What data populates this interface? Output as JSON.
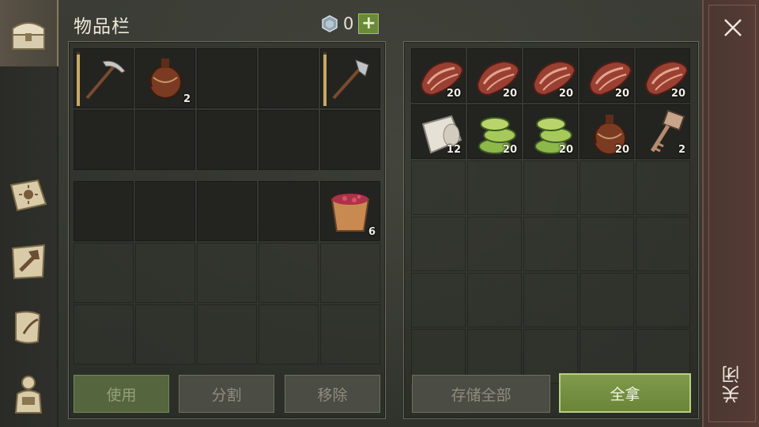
{
  "header": {
    "title": "物品栏",
    "currency_count": "0",
    "add_label": "+"
  },
  "close": {
    "label": "关闭"
  },
  "sidebar": [
    {
      "name": "chest-tab",
      "icon": "chest-icon",
      "active": true
    },
    {
      "name": "sun-book-tab",
      "icon": "sun-book-icon",
      "active": false
    },
    {
      "name": "crafting-tab",
      "icon": "hammer-map-icon",
      "active": false
    },
    {
      "name": "scroll-tab",
      "icon": "quest-scroll-icon",
      "active": false
    },
    {
      "name": "character-tab",
      "icon": "character-icon",
      "active": false
    }
  ],
  "hotbar": [
    {
      "item": "pickaxe",
      "qty": "",
      "durability": 0.95
    },
    {
      "item": "flask",
      "qty": "2"
    },
    {
      "item": "",
      "qty": ""
    },
    {
      "item": "",
      "qty": ""
    },
    {
      "item": "hatchet",
      "qty": "",
      "durability": 0.95
    },
    {
      "item": "",
      "qty": ""
    },
    {
      "item": "",
      "qty": ""
    },
    {
      "item": "",
      "qty": ""
    },
    {
      "item": "",
      "qty": ""
    },
    {
      "item": "",
      "qty": ""
    }
  ],
  "backpack": [
    {
      "item": "",
      "qty": ""
    },
    {
      "item": "",
      "qty": ""
    },
    {
      "item": "",
      "qty": ""
    },
    {
      "item": "",
      "qty": ""
    },
    {
      "item": "berry-bucket",
      "qty": "6"
    },
    {
      "item": "",
      "qty": ""
    },
    {
      "item": "",
      "qty": ""
    },
    {
      "item": "",
      "qty": ""
    },
    {
      "item": "",
      "qty": ""
    },
    {
      "item": "",
      "qty": ""
    },
    {
      "item": "",
      "qty": ""
    },
    {
      "item": "",
      "qty": ""
    },
    {
      "item": "",
      "qty": ""
    },
    {
      "item": "",
      "qty": ""
    },
    {
      "item": "",
      "qty": ""
    }
  ],
  "storage": [
    {
      "item": "meat",
      "qty": "20"
    },
    {
      "item": "meat",
      "qty": "20"
    },
    {
      "item": "meat",
      "qty": "20"
    },
    {
      "item": "meat",
      "qty": "20"
    },
    {
      "item": "meat",
      "qty": "20"
    },
    {
      "item": "cloth",
      "qty": "12"
    },
    {
      "item": "cactus",
      "qty": "20"
    },
    {
      "item": "cactus",
      "qty": "20"
    },
    {
      "item": "flask",
      "qty": "20"
    },
    {
      "item": "key",
      "qty": "2"
    },
    {
      "item": "",
      "qty": ""
    },
    {
      "item": "",
      "qty": ""
    },
    {
      "item": "",
      "qty": ""
    },
    {
      "item": "",
      "qty": ""
    },
    {
      "item": "",
      "qty": ""
    },
    {
      "item": "",
      "qty": ""
    },
    {
      "item": "",
      "qty": ""
    },
    {
      "item": "",
      "qty": ""
    },
    {
      "item": "",
      "qty": ""
    },
    {
      "item": "",
      "qty": ""
    },
    {
      "item": "",
      "qty": ""
    },
    {
      "item": "",
      "qty": ""
    },
    {
      "item": "",
      "qty": ""
    },
    {
      "item": "",
      "qty": ""
    },
    {
      "item": "",
      "qty": ""
    },
    {
      "item": "",
      "qty": ""
    },
    {
      "item": "",
      "qty": ""
    },
    {
      "item": "",
      "qty": ""
    },
    {
      "item": "",
      "qty": ""
    },
    {
      "item": "",
      "qty": ""
    }
  ],
  "buttons": {
    "use": "使用",
    "split": "分割",
    "remove": "移除",
    "store_all": "存储全部",
    "take_all": "全拿"
  },
  "colors": {
    "accent_green": "#7f9a4a",
    "close_panel": "#563c35"
  }
}
